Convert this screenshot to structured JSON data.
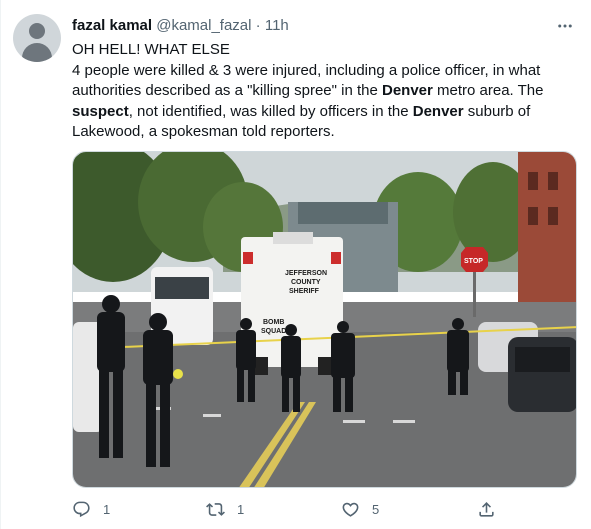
{
  "tweet": {
    "author_name": "fazal kamal",
    "author_handle": "@kamal_fazal",
    "separator": "·",
    "time": "11h",
    "line1": "OH HELL! WHAT ELSE",
    "line2_parts": {
      "a": "4 people were killed & 3 were injured, including a police officer, in what authorities described as a \"killing spree\" in the ",
      "b": "Denver",
      "c": " metro area. The ",
      "d": "suspect",
      "e": ", not identified, was killed by officers in the ",
      "f": "Denver",
      "g": " suburb of Lakewood, a spokesman told reporters."
    }
  },
  "media": {
    "truck_text_1": "JEFFERSON",
    "truck_text_2": "COUNTY",
    "truck_text_3": "SHERIFF",
    "truck_text_4": "BOMB",
    "truck_text_5": "SQUAD",
    "stop_sign": "STOP"
  },
  "actions": {
    "reply_count": "1",
    "retweet_count": "1",
    "like_count": "5"
  },
  "icons": {
    "reply": "reply-icon",
    "retweet": "retweet-icon",
    "like": "heart-icon",
    "share": "share-icon",
    "more": "more-icon"
  },
  "colors": {
    "text_primary": "#0f1419",
    "text_secondary": "#536471"
  }
}
